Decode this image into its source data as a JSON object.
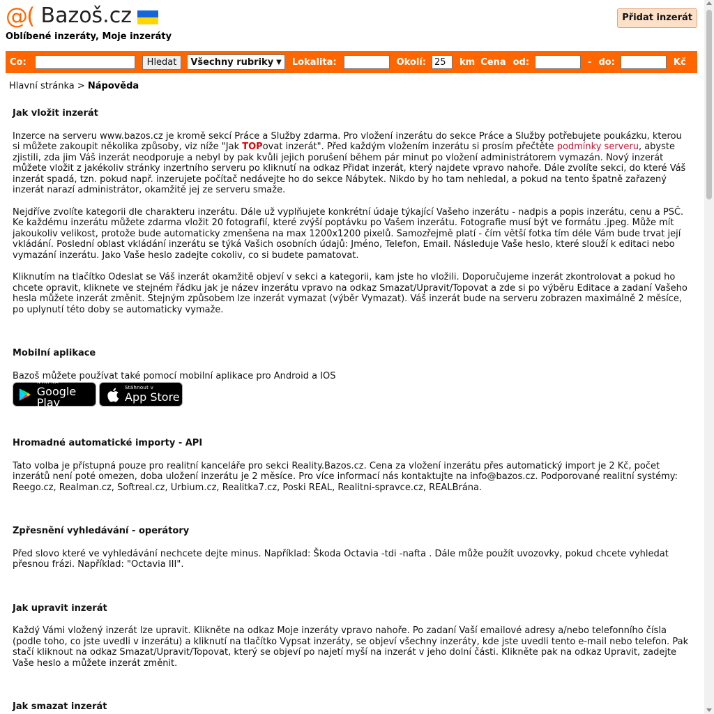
{
  "header": {
    "logo_at": "@(",
    "logo_name": "Bazoš.cz",
    "favorites_link": "Oblíbené inzeráty",
    "separator": ",",
    "my_ads_link": "Moje inzeráty",
    "add_button": "Přidat inzerát"
  },
  "search": {
    "co_label": "Co:",
    "co_value": "",
    "submit_label": "Hledat",
    "category_selected": "Všechny rubriky",
    "locality_label": "Lokalita:",
    "locality_value": "",
    "radius_label": "Okolí:",
    "radius_value": "25",
    "radius_unit": "km",
    "price_label": "Cena",
    "price_from_label": "od:",
    "price_from_value": "",
    "price_dash": "-",
    "price_to_label": "do:",
    "price_to_value": "",
    "currency": "Kč"
  },
  "breadcrumb": {
    "home": "Hlavní stránka",
    "sep": ">",
    "current": "Nápověda"
  },
  "sections": {
    "insert": {
      "title": "Jak vložit inzerát",
      "p1_a": "Inzerce na serveru www.bazos.cz je kromě sekcí Práce a Služby zdarma. Pro vložení inzerátu do sekce Práce a Služby potřebujete poukázku, kterou si můžete zakoupit několika způsoby, viz níže \"Jak ",
      "p1_top": "TOP",
      "p1_b": "ovat inzerát\". Před každým vložením inzerátu si prosím přečtěte ",
      "p1_link": "podmínky serveru",
      "p1_c": ", abyste zjistili, zda jim Váš inzerát neodporuje a nebyl by pak kvůli jejich porušení během pár minut po vložení administrátorem vymazán. Nový inzerát můžete vložit z jakékoliv stránky inzertního serveru po kliknutí na odkaz Přidat inzerát, který najdete vpravo nahoře. Dále zvolíte sekci, do které Váš inzerát spadá, tzn. pokud např. inzerujete počítač nedávejte ho do sekce Nábytek. Nikdo by ho tam nehledal, a pokud na tento špatně zařazený inzerát narazí administrátor, okamžitě jej ze serveru smaže.",
      "p2": "Nejdříve zvolíte kategorii dle charakteru inzerátu. Dále už vyplňujete konkrétní údaje týkající Vašeho inzerátu - nadpis a popis inzerátu, cenu a PSČ. Ke každému inzerátu můžete zdarma vložit 20 fotografií, které zvýší poptávku po Vašem inzerátu. Fotografie musí být ve formátu .jpeg. Může mít jakoukoliv velikost, protože bude automaticky zmenšena na max 1200x1200 pixelů. Samozřejmě platí - čím větší fotka tím déle Vám bude trvat její vkládání. Poslední oblast vkládání inzerátu se týká Vašich osobních údajů: Jméno, Telefon, Email. Následuje Vaše heslo, které slouží k editaci nebo vymazání inzerátu. Jako Vaše heslo zadejte cokoliv, co si budete pamatovat.",
      "p3": "Kliknutím na tlačítko Odeslat se Váš inzerát okamžitě objeví v sekci a kategorii, kam jste ho vložili. Doporučujeme inzerát zkontrolovat a pokud ho chcete opravit, kliknete ve stejném řádku jak je název inzerátu vpravo na odkaz Smazat/Upravit/Topovat a zde si po výběru Editace a zadaní Vašeho hesla můžete inzerát změnit. Stejným způsobem lze inzerát vymazat (výběr Vymazat). Váš inzerát bude na serveru zobrazen maximálně 2 měsíce, po uplynutí této doby se automaticky vymaže."
    },
    "mobile": {
      "title": "Mobilní aplikace",
      "text": "Bazoš můžete používat také pomocí mobilní aplikace pro Android a IOS",
      "gp_small": "NYNÍ NA",
      "gp_big": "Google Play",
      "as_small": "Stáhnout v",
      "as_big": "App Store"
    },
    "api": {
      "title": "Hromadné automatické importy - API",
      "text": "Tato volba je přístupná pouze pro realitní kanceláře pro sekci Reality.Bazos.cz. Cena za vložení inzerátu přes automatický import je 2 Kč, počet inzerátů není poté omezen, doba uložení inzerátu je 2 měsíce. Pro více informací nás kontaktujte na info@bazos.cz. Podporované realitní systémy: Reego.cz, Realman.cz, Softreal.cz, Urbium.cz, Realitka7.cz, Poski REAL, Realitni-spravce.cz, REALBrána."
    },
    "operators": {
      "title": "Zpřesnění vyhledávání - operátory",
      "text": "Před slovo které ve vyhledávání nechcete dejte minus. Například: Škoda Octavia -tdi -nafta . Dále může použít uvozovky, pokud chcete vyhledat přesnou frázi. Například: \"Octavia III\"."
    },
    "edit": {
      "title": "Jak upravit inzerát",
      "text": "Každý Vámi vložený inzerát lze upravit. Klikněte na odkaz Moje inzeráty vpravo nahoře. Po zadaní Vaší emailové adresy a/nebo telefonního čísla (podle toho, co jste uvedli v inzerátu) a kliknutí na tlačítko Vypsat inzeráty, se objeví všechny inzeráty, kde jste uvedli tento e-mail nebo telefon. Pak stačí kliknout na odkaz Smazat/Upravit/Topovat, který se objeví po najetí myší na inzerát v jeho dolní části. Klikněte pak na odkaz Upravit, zadejte Vaše heslo a můžete inzerát změnit."
    },
    "delete": {
      "title": "Jak smazat inzerát"
    }
  },
  "colors": {
    "brand_orange": "#ff6600",
    "button_bg": "#fde0c8",
    "top_red": "#e00000",
    "link_red": "#c8102e",
    "flag_blue": "#1565d8",
    "flag_yellow": "#ffd600"
  },
  "icons": [
    "ukraine-flag-icon",
    "google-play-icon",
    "apple-icon",
    "select-caret-icon"
  ]
}
